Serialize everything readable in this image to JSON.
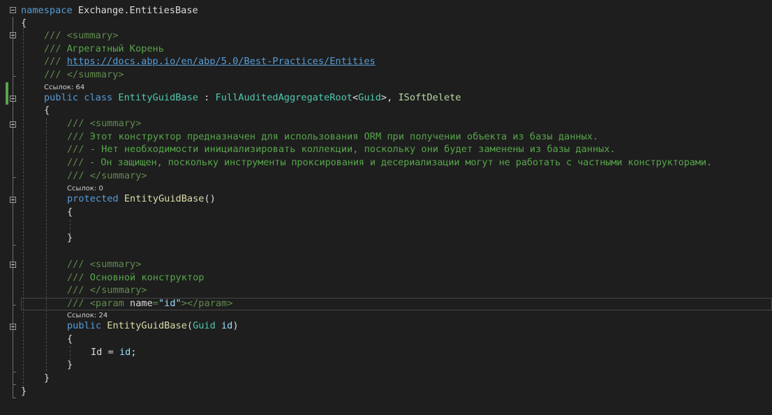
{
  "code": {
    "ns_keyword": "namespace",
    "ns_name": "Exchange.EntitiesBase",
    "open_brace": "{",
    "close_brace": "}",
    "doc_prefix": "///",
    "summary_open": "<summary>",
    "summary_close": "</summary>",
    "class_summary_text": "Агрегатный Корень",
    "class_summary_link": "https://docs.abp.io/en/abp/5.0/Best-Practices/Entities",
    "class_refs": "Ссылок: 64",
    "kw_public": "public",
    "kw_class": "class",
    "class_name": "EntityGuidBase",
    "colon": ":",
    "base_class": "FullAuditedAggregateRoot",
    "lt": "<",
    "gt_comma": ">,",
    "generic_arg": "Guid",
    "interface": "ISoftDelete",
    "ctor1_summary_lines": [
      "Этот конструктор предназначен для использования ORM при получении объекта из базы данных.",
      "- Нет необходимости инициализировать коллекции, поскольку они будет заменены из базы данных.",
      "- Он защищен, поскольку инструменты проксирования и десериализации могут не работать с частными конструкторами."
    ],
    "ctor1_refs": "Ссылок: 0",
    "kw_protected": "protected",
    "ctor_name": "EntityGuidBase",
    "parens_empty": "()",
    "ctor2_summary_text": "Основной конструктор",
    "param_tag_open": "<param",
    "param_attr": "name",
    "param_eq": "=",
    "param_value": "\"id\"",
    "param_tag_close": "></param>",
    "ctor2_refs": "Ссылок: 24",
    "paren_open": "(",
    "param_type": "Guid",
    "param_name": "id",
    "paren_close": ")",
    "assign_target": "Id",
    "assign_op": "=",
    "assign_value": "id",
    "semicolon": ";"
  },
  "colors": {
    "background": "#1e1e1e",
    "keyword": "#569cd6",
    "type": "#4ec9b0",
    "comment": "#57a64a",
    "change_bar": "#57a64a"
  }
}
